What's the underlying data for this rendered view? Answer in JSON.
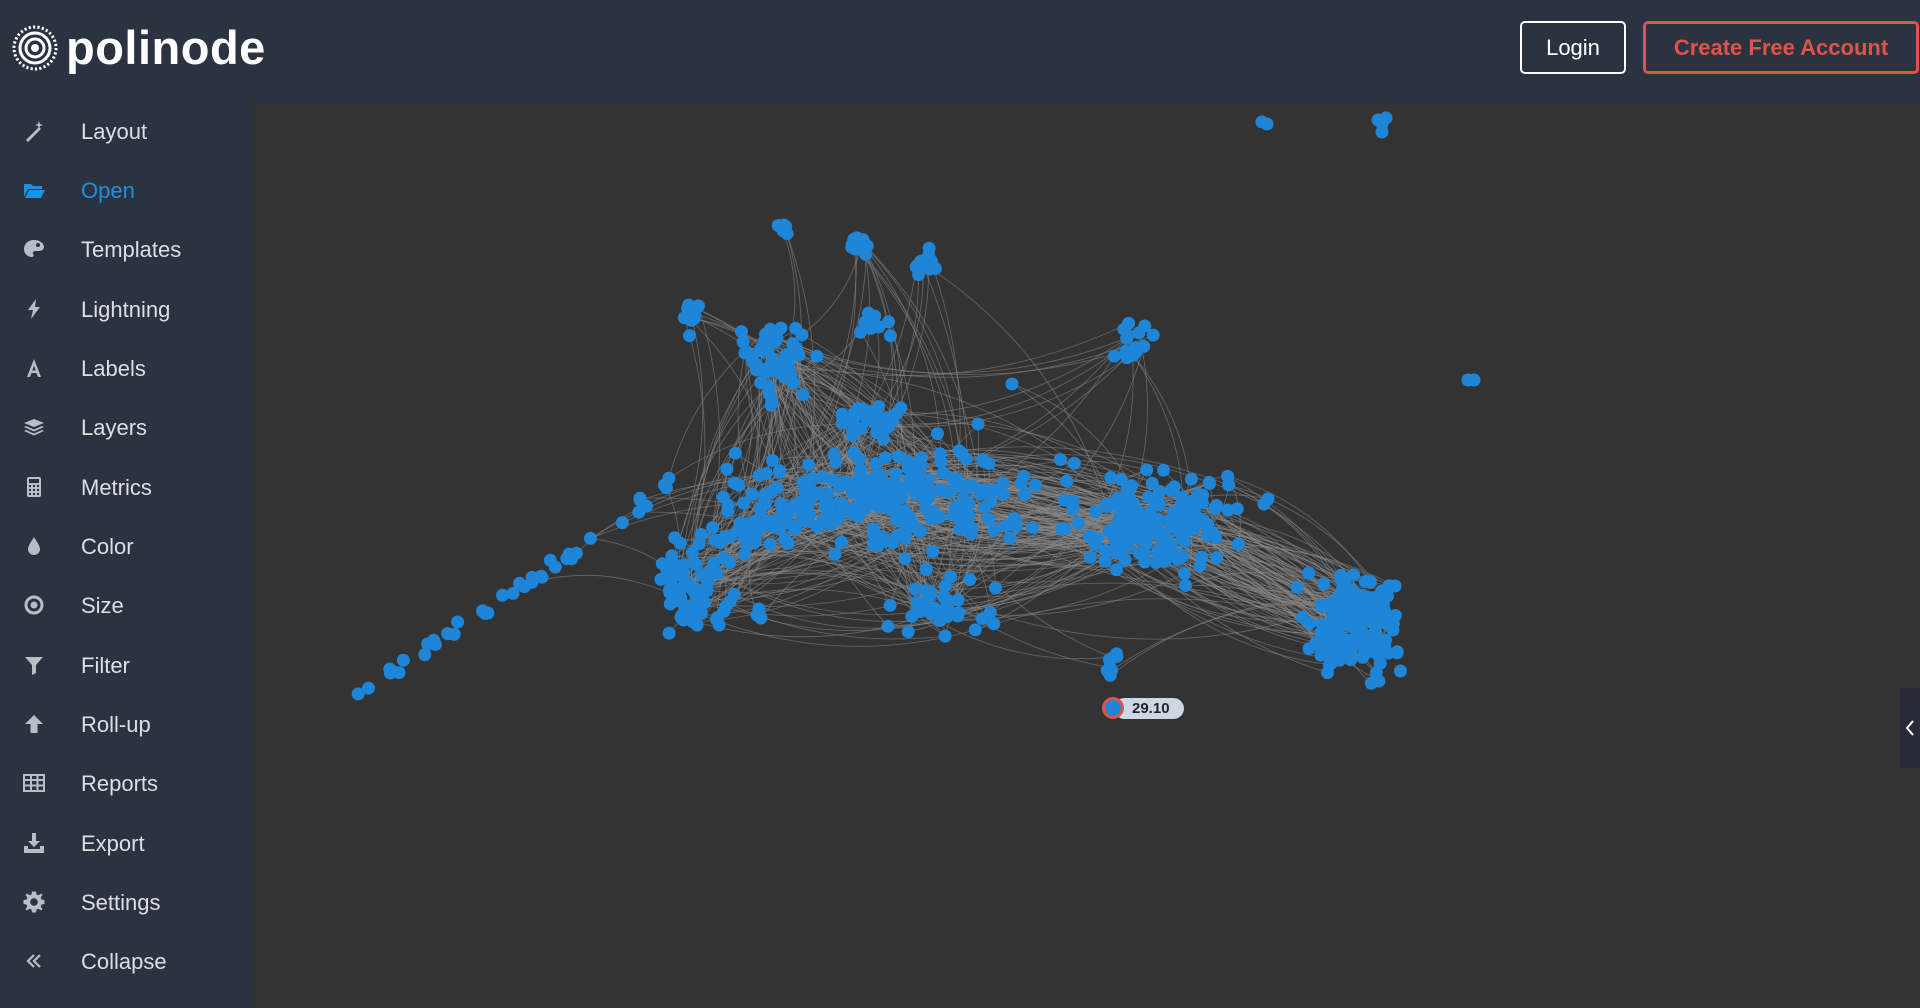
{
  "header": {
    "brand_name": "polinode",
    "login_label": "Login",
    "create_account_label": "Create Free Account"
  },
  "sidebar": {
    "items": [
      {
        "label": "Layout",
        "icon": "magic-wand-icon",
        "active": false
      },
      {
        "label": "Open",
        "icon": "folder-open-icon",
        "active": true
      },
      {
        "label": "Templates",
        "icon": "palette-icon",
        "active": false
      },
      {
        "label": "Lightning",
        "icon": "lightning-icon",
        "active": false
      },
      {
        "label": "Labels",
        "icon": "font-icon",
        "active": false
      },
      {
        "label": "Layers",
        "icon": "layers-icon",
        "active": false
      },
      {
        "label": "Metrics",
        "icon": "calculator-icon",
        "active": false
      },
      {
        "label": "Color",
        "icon": "droplet-icon",
        "active": false
      },
      {
        "label": "Size",
        "icon": "dot-circle-icon",
        "active": false
      },
      {
        "label": "Filter",
        "icon": "filter-icon",
        "active": false
      },
      {
        "label": "Roll-up",
        "icon": "arrow-up-icon",
        "active": false
      },
      {
        "label": "Reports",
        "icon": "table-icon",
        "active": false
      },
      {
        "label": "Export",
        "icon": "download-icon",
        "active": false
      },
      {
        "label": "Settings",
        "icon": "gear-icon",
        "active": false
      },
      {
        "label": "Collapse",
        "icon": "double-chevron-left-icon",
        "active": false
      }
    ]
  },
  "network": {
    "selected_metric": "29.10"
  },
  "colors": {
    "background": "#333333",
    "sidebar": "#2c3340",
    "accent": "#1f8fe0",
    "node": "#1f85d6",
    "edge": "#8a8a8a",
    "danger": "#e0534b"
  }
}
